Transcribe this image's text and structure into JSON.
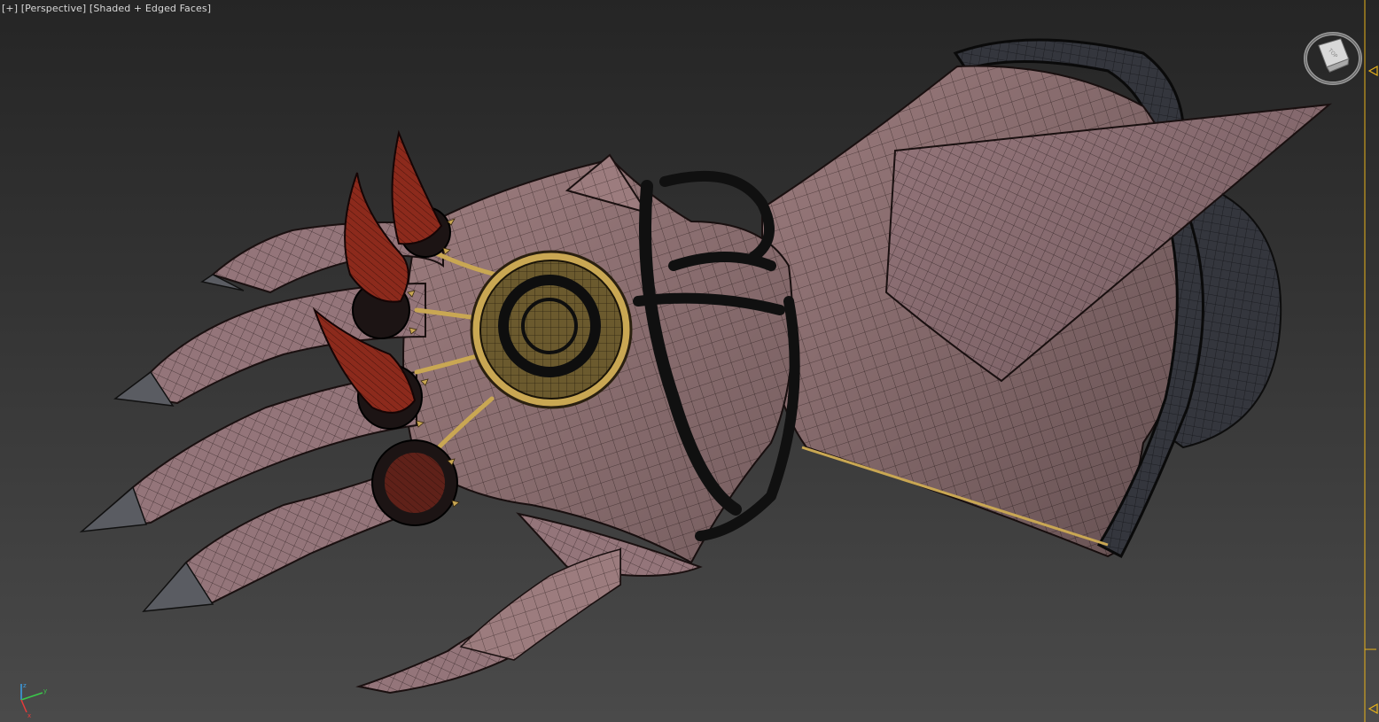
{
  "viewport": {
    "menu_label": "[+]",
    "view_label": "[Perspective]",
    "shading_label": "[Shaded + Edged Faces]"
  },
  "viewcube": {
    "face_label": "TOP"
  },
  "axis": {
    "x_label": "x",
    "y_label": "y",
    "z_label": "z"
  },
  "colors": {
    "background_top": "#252525",
    "background_bottom": "#4a4a4a",
    "gauntlet_skin": "#9c7c7e",
    "horn": "#8c2a1c",
    "gold_trim": "#c9a753",
    "ring_inner": "#6b5a2e",
    "strap": "#101010",
    "rim_dark": "#2f3238",
    "ruler_accent": "#e8b21a"
  },
  "icons": {
    "viewcube": "viewcube-icon",
    "axis": "axis-tripod-icon",
    "ruler_marker": "triangle-marker-icon"
  }
}
